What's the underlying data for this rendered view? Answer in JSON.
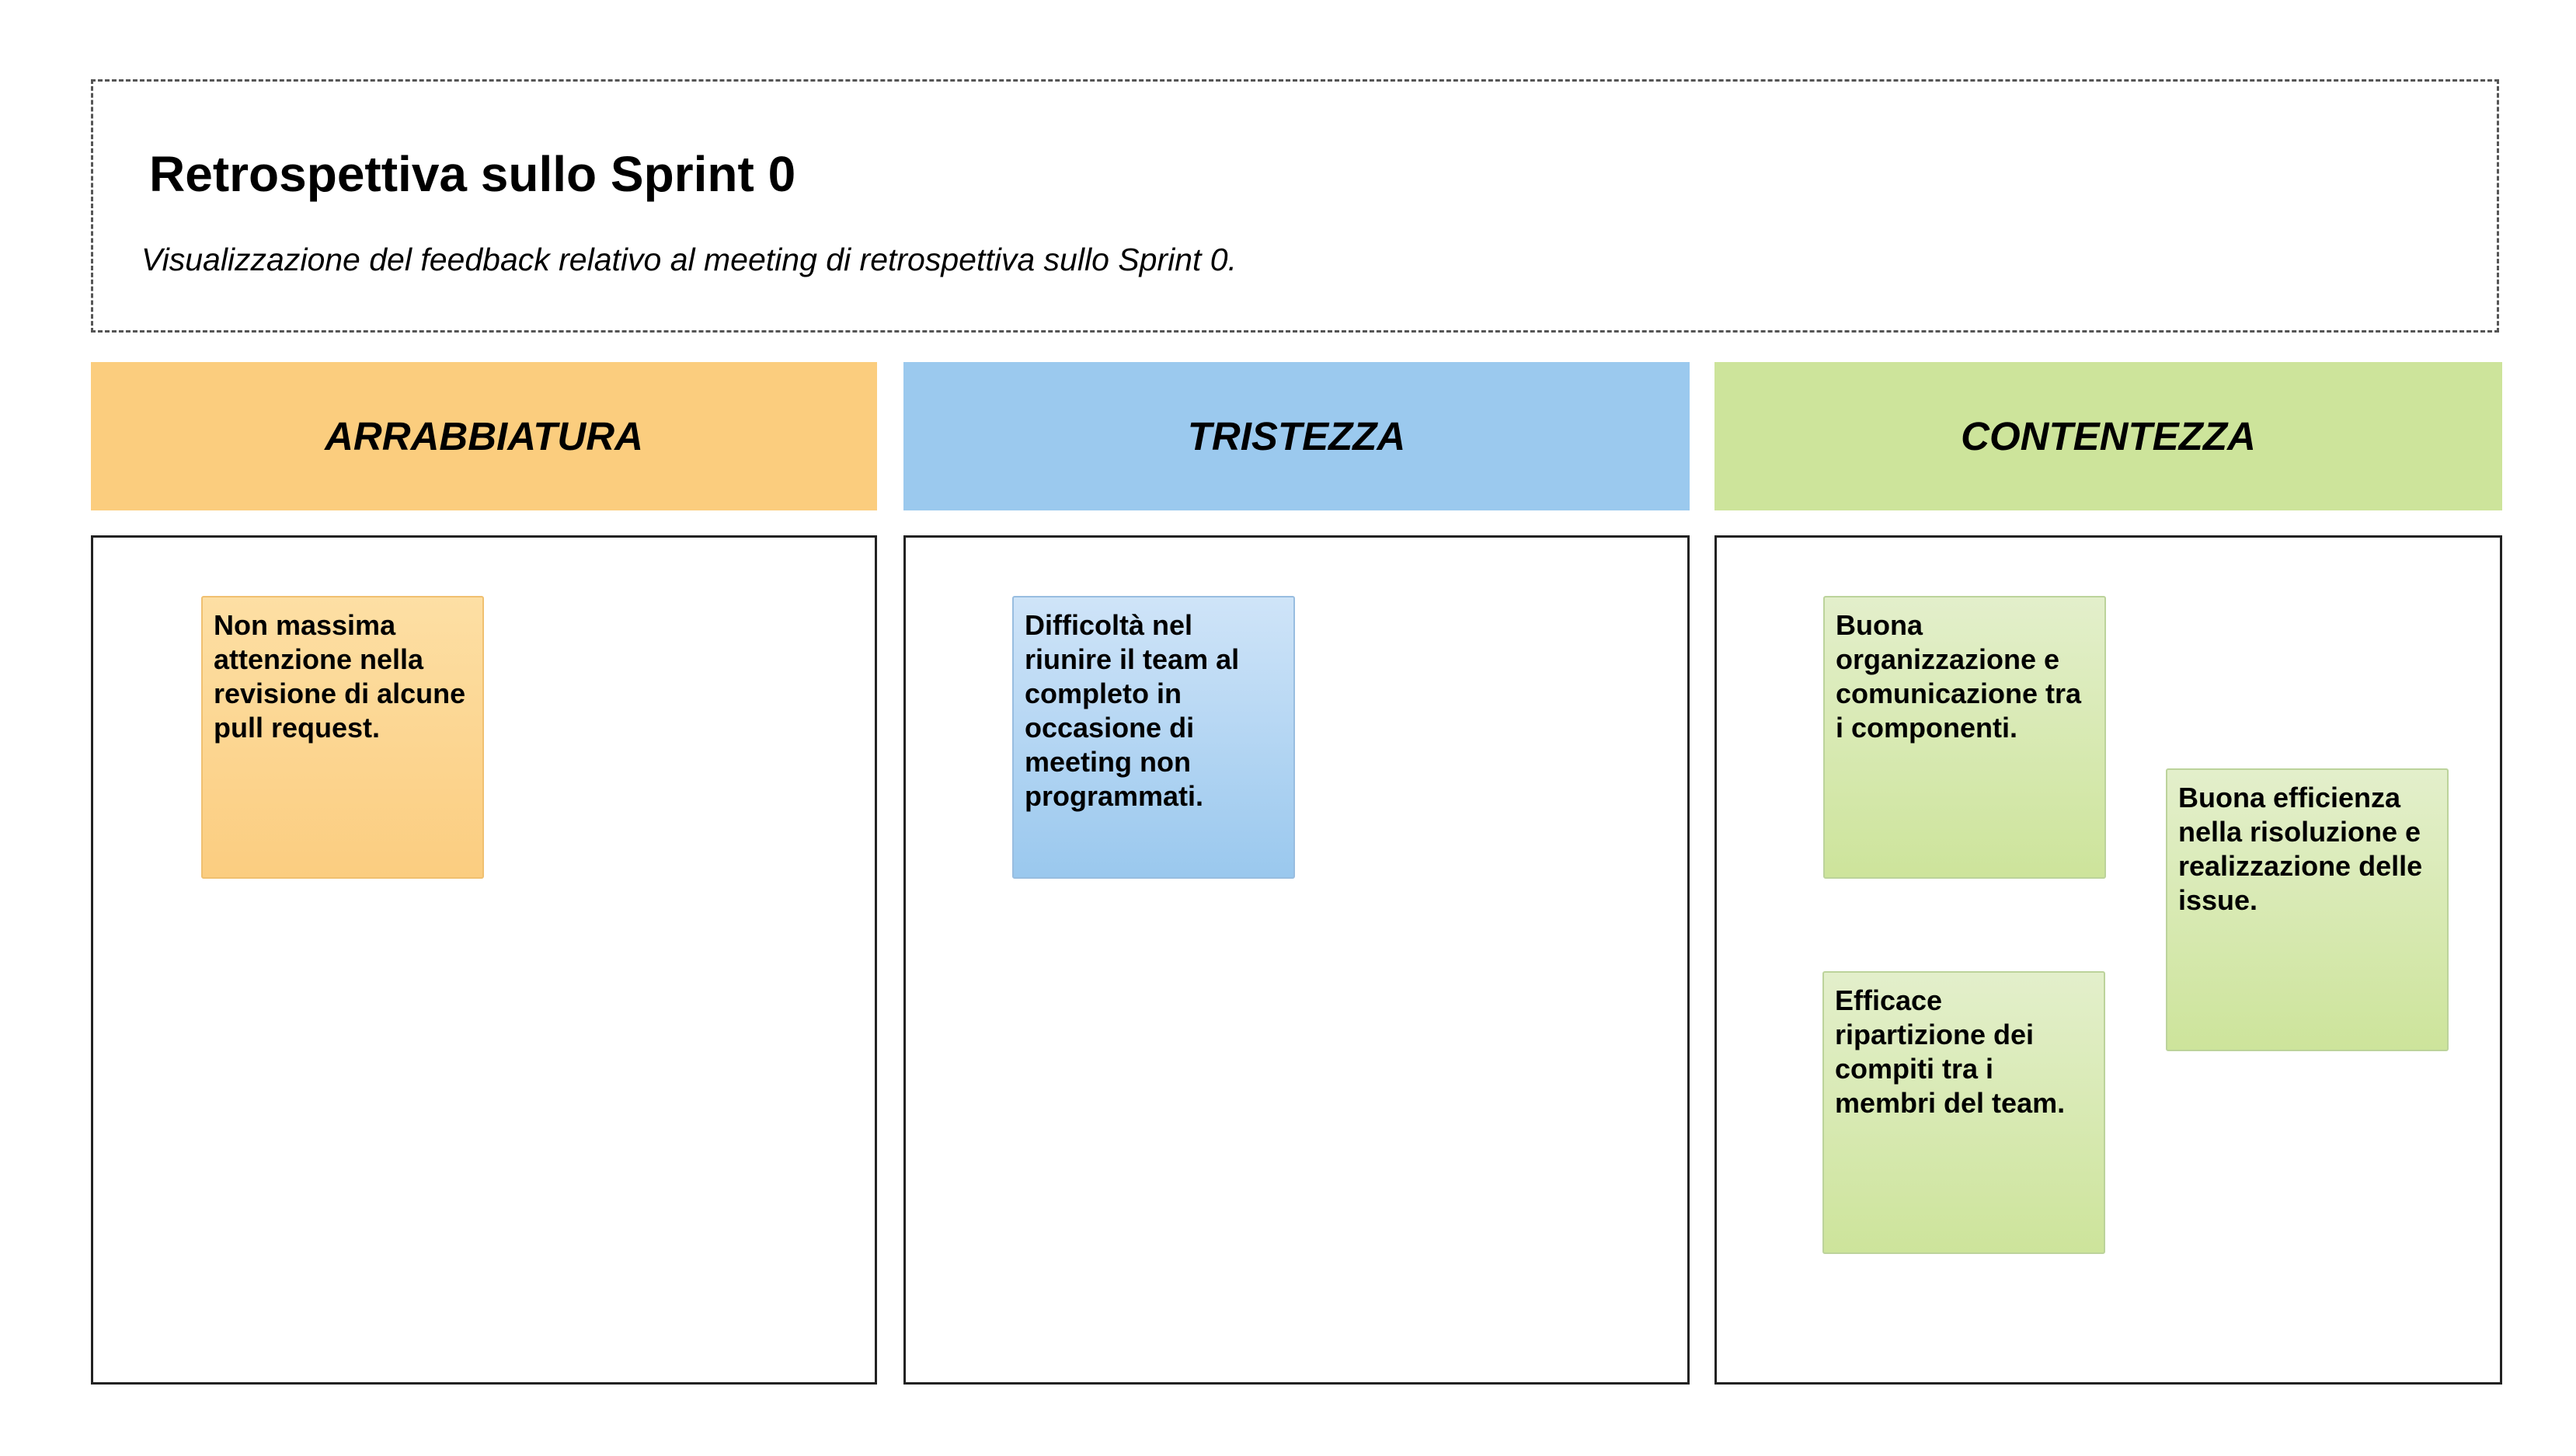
{
  "header": {
    "title": "Retrospettiva sullo Sprint 0",
    "subtitle": "Visualizzazione del feedback relativo al meeting di retrospettiva sullo Sprint 0."
  },
  "columns": [
    {
      "label": "ARRABBIATURA",
      "color": "#fbcd7e",
      "notes": [
        "Non massima attenzione nella revisione di alcune pull request."
      ]
    },
    {
      "label": "TRISTEZZA",
      "color": "#9bc9ee",
      "notes": [
        "Difficoltà nel riunire il team al completo in occasione di meeting non programmati."
      ]
    },
    {
      "label": "CONTENTEZZA",
      "color": "#cde49b",
      "notes": [
        "Buona organizzazione e comunicazione tra i componenti.",
        "Buona efficienza nella risoluzione e realizzazione delle issue.",
        "Efficace ripartizione dei compiti tra i membri del team."
      ]
    }
  ]
}
